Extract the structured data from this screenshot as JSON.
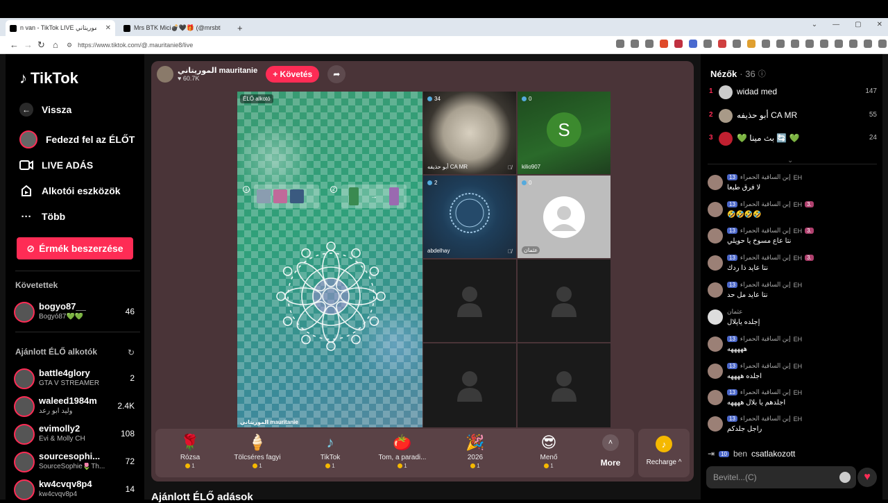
{
  "browser": {
    "tabs": [
      {
        "title": "n van - TikTok LIVE الموريتاني",
        "active": true
      },
      {
        "title": "Mrs BTK Mici💣🖤🎁 (@mrsbtk) | T",
        "active": false
      }
    ],
    "new_tab": "+",
    "url": "https://www.tiktok.com/@.mauritanie8/live",
    "win_controls": [
      "⌄",
      "—",
      "▢",
      "✕"
    ]
  },
  "sidebar": {
    "logo": "TikTok",
    "back": "Vissza",
    "nav": [
      {
        "label": "Fedezd fel az ÉLŐT",
        "icon": "avatar"
      },
      {
        "label": "LIVE ADÁS",
        "icon": "video-camera-icon"
      },
      {
        "label": "Alkotói eszközök",
        "icon": "creator-tools-icon"
      },
      {
        "label": "Több",
        "icon": "more-icon"
      }
    ],
    "coins_button": "Érmék beszerzése",
    "following_title": "Követettek",
    "following": [
      {
        "name": "bogyo87__",
        "sub": "Bogyó87💚💚",
        "count": "46"
      }
    ],
    "recommended_title": "Ajánlott ÉLŐ alkotók",
    "recommended": [
      {
        "name": "battle4glory",
        "sub": "GTA V STREAMER",
        "count": "2"
      },
      {
        "name": "waleed1984m",
        "sub": "وليد ابو رعد",
        "count": "2.4K"
      },
      {
        "name": "evimolly2",
        "sub": "Évi & Molly CH",
        "count": "108"
      },
      {
        "name": "sourcesophi...",
        "sub": "SourceSophie🌷Th...",
        "count": "72"
      },
      {
        "name": "kw4cvqv8p4",
        "sub": "kw4cvqv8p4",
        "count": "14"
      }
    ]
  },
  "stage": {
    "host_name": "الموريتاني mauritanie",
    "host_likes": "60.7K",
    "follow": "+ Követés",
    "live_tag": "ÉLŐ alkotó",
    "main_label": "الموريتاني mauritanie",
    "tut_steps": [
      "1",
      "2"
    ],
    "guests": [
      {
        "count": "34",
        "name": "أبو حذيفه CA MR",
        "muted": true
      },
      {
        "count": "0",
        "name": "kilio907",
        "initial": "S",
        "muted": false
      },
      {
        "count": "2",
        "name": "abdelhay",
        "muted": true
      },
      {
        "count": "0",
        "name": "عثمان",
        "muted": false
      }
    ]
  },
  "gifts": [
    {
      "name": "Rózsa",
      "price": "1",
      "icon": "🌹"
    },
    {
      "name": "Tölcséres fagyi",
      "price": "1",
      "icon": "🍦"
    },
    {
      "name": "TikTok",
      "price": "1",
      "icon": "♪"
    },
    {
      "name": "Tom, a paradi...",
      "price": "1",
      "icon": "🍅"
    },
    {
      "name": "2026",
      "price": "1",
      "icon": "🎉"
    },
    {
      "name": "Menő",
      "price": "1",
      "icon": "😎"
    }
  ],
  "more_label": "More",
  "recharge_label": "Recharge ^",
  "recommended_heading": "Ajánlott ÉLŐ adások",
  "viewers": {
    "title": "Nézők",
    "count": "· 36",
    "top": [
      {
        "rank": "1",
        "name": "widad med",
        "score": "147"
      },
      {
        "rank": "2",
        "name": "أبو حذيفه CA MR",
        "score": "55"
      },
      {
        "rank": "3",
        "name": "💚 بث مينا 🔄 💚",
        "score": "24"
      }
    ]
  },
  "chat": [
    {
      "user": "إبن الساقية الحمراء",
      "level": "13",
      "badge": "EH",
      "fan": "",
      "text": "لا فرق طبعا"
    },
    {
      "user": "إبن الساقية الحمراء",
      "level": "13",
      "badge": "EH",
      "fan": "3.",
      "text": "🤣🤣🤣🤣"
    },
    {
      "user": "إبن الساقية الحمراء",
      "level": "13",
      "badge": "EH",
      "fan": "3.",
      "text": "نتا عاع مسوخ يا حويلي"
    },
    {
      "user": "إبن الساقية الحمراء",
      "level": "13",
      "badge": "EH",
      "fan": "3.",
      "text": "نتا عايد ذا ردك"
    },
    {
      "user": "إبن الساقية الحمراء",
      "level": "13",
      "badge": "EH",
      "fan": "",
      "text": "نتا عايد مل حد"
    },
    {
      "user": "عثمان",
      "level": "",
      "badge": "",
      "fan": "",
      "text": "إجلده ياپلال"
    },
    {
      "user": "إبن الساقية الحمراء",
      "level": "13",
      "badge": "EH",
      "fan": "",
      "text": "هههههه"
    },
    {
      "user": "إبن الساقية الحمراء",
      "level": "13",
      "badge": "EH",
      "fan": "",
      "text": "اجلده ههههه"
    },
    {
      "user": "إبن الساقية الحمراء",
      "level": "13",
      "badge": "EH",
      "fan": "",
      "text": "اجلدهم يا بلال ههههه"
    },
    {
      "user": "إبن الساقية الحمراء",
      "level": "13",
      "badge": "EH",
      "fan": "",
      "text": "راجل جلدكم"
    }
  ],
  "joined": {
    "level": "10",
    "name": "ben",
    "action": "csatlakozott"
  },
  "input_placeholder": "Bevitel...(C)"
}
